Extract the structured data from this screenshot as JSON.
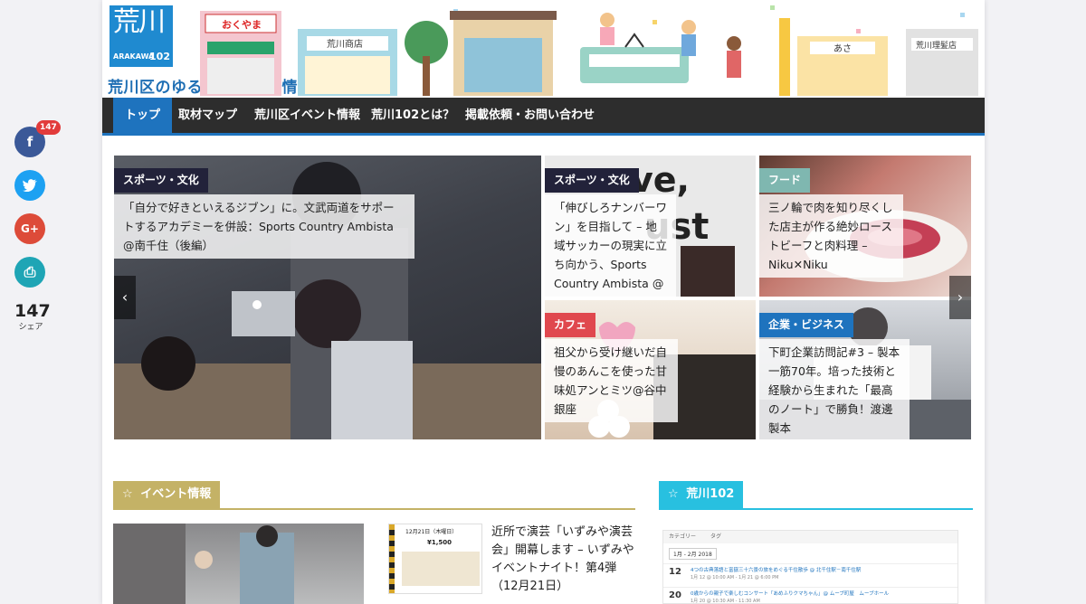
{
  "header": {
    "logo_kanji": "荒川",
    "logo_sub": "ARAKAWA",
    "logo_num": "102",
    "tagline": "荒川区のゆる系ローカル情報マガジン",
    "shop_signs": [
      "おくやま",
      "荒川商店",
      "荒川理髪店",
      "あさ"
    ]
  },
  "nav": {
    "items": [
      {
        "label": "トップ",
        "active": true
      },
      {
        "label": "取材マップ"
      },
      {
        "label": "荒川区イベント情報"
      },
      {
        "label": "荒川102とは？"
      },
      {
        "label": "掲載依頼・お問い合わせ"
      }
    ]
  },
  "share": {
    "badge": "147",
    "count": "147",
    "count_label": "シェア",
    "buttons": [
      {
        "icon": "facebook-icon",
        "glyph": "f",
        "color": "#3b5998"
      },
      {
        "icon": "twitter-icon",
        "glyph": "🐦",
        "color": "#1da1f2"
      },
      {
        "icon": "google-plus-icon",
        "glyph": "G+",
        "color": "#dd4b39"
      },
      {
        "icon": "print-icon",
        "glyph": "⎙",
        "color": "#1fa5b5"
      }
    ]
  },
  "slider": {
    "prev_glyph": "‹",
    "next_glyph": "›",
    "slides": [
      {
        "category": "スポーツ・文化",
        "cat_color": "#22223a",
        "title": "「自分で好きといえるジブン」に。文武両道をサポートするアカデミーを併設：Sports Country Ambista @南千住（後編）"
      },
      {
        "category": "スポーツ・文化",
        "cat_color": "#22223a",
        "title": "「伸びしろナンバーワン」を目指して – 地域サッカーの現実に立ち向かう、Sports Country Ambista @南千住（前編）"
      },
      {
        "category": "フード",
        "cat_color": "#7fb7b0",
        "title": "三ノ輪で肉を知り尽くした店主が作る絶妙ローストビーフと肉料理 – Niku✕Niku"
      },
      {
        "category": "カフェ",
        "cat_color": "#e0484e",
        "title": "祖父から受け継いだ自慢のあんこを使った甘味処アンとミツ@谷中銀座"
      },
      {
        "category": "企業・ビジネス",
        "cat_color": "#1e73be",
        "title": "下町企業訪問記#3 – 製本一筋70年。培った技術と経験から生まれた「最高のノート」で勝負！渡邊製本"
      }
    ]
  },
  "events": {
    "heading": "イベント情報",
    "star": "☆",
    "color": "#c4b266",
    "flyer": {
      "date": "12月21日（木曜日）",
      "price": "¥1,500"
    },
    "post_title": "近所で演芸「いずみや演芸会」開幕します – いずみやイベントナイト！第4弾（12月21日）"
  },
  "arakawa": {
    "heading": "荒川102",
    "star": "☆",
    "color": "#28c0e0",
    "calendar": {
      "toolbar": [
        "カテゴリー",
        "タグ"
      ],
      "range": "1月 - 2月 2018",
      "rows": [
        {
          "date": "12",
          "dow": "金",
          "title": "4つの古典落語と富嶽三十六景の旅をめぐる千住散歩 @ 北千住駅－南千住駅",
          "time": "1月 12 @ 10:00 AM - 1月 21 @ 6:00 PM"
        },
        {
          "date": "20",
          "dow": "土",
          "title": "0歳からの親子で楽しむコンサート「あめふりクマちゃん」@ ムーブ町屋　ムーブホール",
          "time": "1月 20 @ 10:30 AM - 11:30 AM"
        }
      ]
    }
  }
}
